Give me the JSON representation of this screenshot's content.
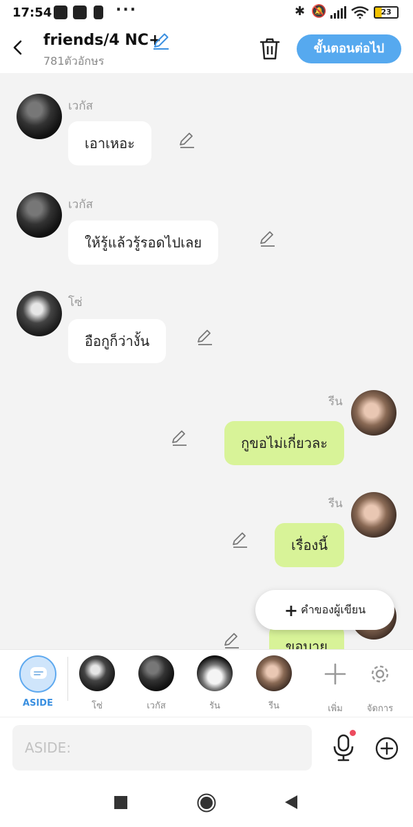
{
  "status_bar": {
    "time": "17:54",
    "battery": "23",
    "icons": [
      "video-app-icon",
      "message-icon",
      "battery-saver-icon",
      "more-dots-icon",
      "bluetooth-icon",
      "mute-icon",
      "signal-icon",
      "wifi-icon",
      "battery-icon"
    ]
  },
  "header": {
    "title": "friends/4 NC+",
    "subtitle": "781ตัวอักษร",
    "next_label": "ขั้นตอนต่อไป"
  },
  "messages": [
    {
      "side": "left",
      "sender": "เวกัส",
      "text": "เอาเหอะ"
    },
    {
      "side": "left",
      "sender": "เวกัส",
      "text": "ให้รู้แล้วรู้รอดไปเลย"
    },
    {
      "side": "left",
      "sender": "โซ่",
      "text": "อือกูก็ว่างั้น"
    },
    {
      "side": "right",
      "sender": "รีน",
      "text": "กูขอไม่เกี่ยวละ"
    },
    {
      "side": "right",
      "sender": "รีน",
      "text": "เรื่องนี้"
    },
    {
      "side": "right",
      "sender": "",
      "text": "ขอบาย"
    }
  ],
  "fab": {
    "label": "คำของผู้เขียน"
  },
  "characters": {
    "aside_label": "ASIDE",
    "items": [
      {
        "label": "โซ่"
      },
      {
        "label": "เวกัส"
      },
      {
        "label": "รัน"
      },
      {
        "label": "รีน"
      }
    ],
    "add_label": "เพิ่ม",
    "manage_label": "จัดการ"
  },
  "input": {
    "placeholder": "ASIDE:"
  },
  "colors": {
    "accent": "#56a9ef",
    "right_bubble": "#d8f398",
    "left_bubble": "#ffffff",
    "background": "#f3f3f3"
  }
}
